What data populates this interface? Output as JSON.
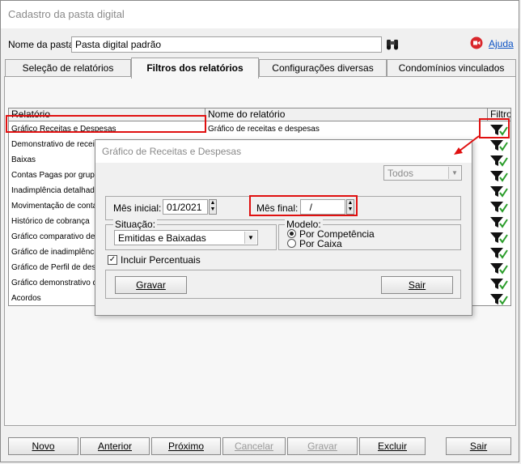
{
  "window": {
    "title": "Cadastro da pasta digital"
  },
  "header": {
    "folder_name_label": "Nome da pasta:",
    "folder_name_value": "Pasta digital padrão",
    "help_label": "Ajuda"
  },
  "tabs": [
    {
      "label": "Seleção de relatórios",
      "active": false
    },
    {
      "label": "Filtros dos relatórios",
      "active": true
    },
    {
      "label": "Configurações diversas",
      "active": false
    },
    {
      "label": "Condomínios vinculados",
      "active": false
    }
  ],
  "grid": {
    "columns": [
      "Relatório",
      "Nome do relatório",
      "Filtro"
    ],
    "rows": [
      {
        "report": "Gráfico Receitas e Despesas",
        "name": "Gráfico de receitas e despesas"
      },
      {
        "report": "Demonstrativo de receita",
        "name": ""
      },
      {
        "report": "Baixas",
        "name": ""
      },
      {
        "report": "Contas Pagas por grupo e",
        "name": ""
      },
      {
        "report": "Inadimplência detalhada",
        "name": ""
      },
      {
        "report": "Movimentação de conta c",
        "name": ""
      },
      {
        "report": "Histórico de cobrança",
        "name": ""
      },
      {
        "report": "Gráfico comparativo de e",
        "name": ""
      },
      {
        "report": "Gráfico de inadimplência a",
        "name": ""
      },
      {
        "report": "Gráfico de Perfil de despe",
        "name": ""
      },
      {
        "report": "Gráfico demonstrativo de",
        "name": ""
      },
      {
        "report": "Acordos",
        "name": ""
      }
    ]
  },
  "dialog": {
    "title": "Gráfico de Receitas e Despesas",
    "scope_select": "Todos",
    "month_start_label": "Mês inicial:",
    "month_start_value": "01/2021",
    "month_end_label": "Mês final:",
    "month_end_value": "  /",
    "situation_label": "Situação:",
    "situation_value": "Emitidas e Baixadas",
    "model_label": "Modelo:",
    "model_options": [
      {
        "label": "Por Competência",
        "selected": true
      },
      {
        "label": "Por Caixa",
        "selected": false
      }
    ],
    "include_percent_label": "Incluir Percentuais",
    "include_percent_checked": true,
    "save_button": "Gravar",
    "exit_button": "Sair"
  },
  "footer_buttons": [
    {
      "label": "Novo",
      "enabled": true
    },
    {
      "label": "Anterior",
      "enabled": true
    },
    {
      "label": "Próximo",
      "enabled": true
    },
    {
      "label": "Cancelar",
      "enabled": false
    },
    {
      "label": "Gravar",
      "enabled": false
    },
    {
      "label": "Excluir",
      "enabled": true
    },
    {
      "label": "Sair",
      "enabled": true
    }
  ],
  "colors": {
    "highlight": "#e01010",
    "link": "#0b52c4",
    "help_icon": "#d9262b",
    "check_green": "#2a9d2a"
  }
}
